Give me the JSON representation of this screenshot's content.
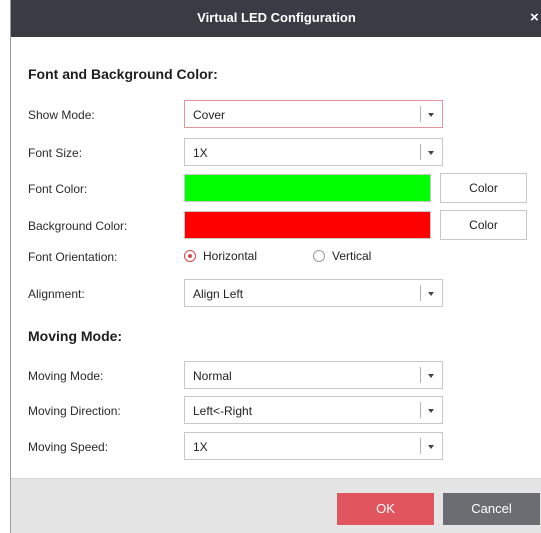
{
  "dialog": {
    "title": "Virtual LED Configuration",
    "close_glyph": "×"
  },
  "font_bg_section": {
    "heading": "Font and Background Color:",
    "show_mode": {
      "label": "Show Mode:",
      "value": "Cover"
    },
    "font_size": {
      "label": "Font Size:",
      "value": "1X"
    },
    "font_color": {
      "label": "Font Color:",
      "swatch": "#00ff00",
      "button": "Color"
    },
    "background_color": {
      "label": "Background Color:",
      "swatch": "#ff0000",
      "button": "Color"
    },
    "font_orientation": {
      "label": "Font Orientation:",
      "options": [
        "Horizontal",
        "Vertical"
      ],
      "selected": "Horizontal"
    },
    "alignment": {
      "label": "Alignment:",
      "value": "Align Left"
    }
  },
  "moving_section": {
    "heading": "Moving Mode:",
    "moving_mode": {
      "label": "Moving Mode:",
      "value": "Normal"
    },
    "moving_direction": {
      "label": "Moving Direction:",
      "value": "Left<-Right"
    },
    "moving_speed": {
      "label": "Moving Speed:",
      "value": "1X"
    }
  },
  "footer": {
    "ok_label": "OK",
    "cancel_label": "Cancel"
  },
  "colors": {
    "accent": "#e0555e",
    "titlebar": "#3a3c44",
    "cancel": "#6b6d73"
  },
  "icons": {
    "dropdown": "chevron-down-icon",
    "close": "close-icon",
    "radio": "radio-icon"
  }
}
